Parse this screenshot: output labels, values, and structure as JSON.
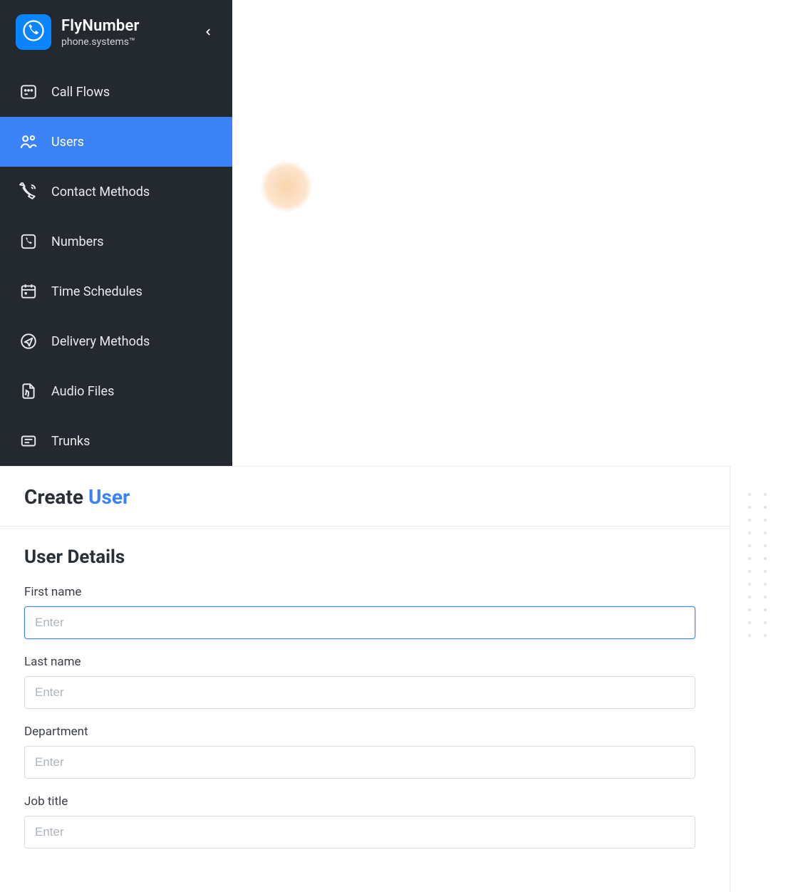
{
  "brand": {
    "name": "FlyNumber",
    "subtitle": "phone.systems™"
  },
  "sidebar": {
    "items": [
      {
        "label": "Call Flows"
      },
      {
        "label": "Users"
      },
      {
        "label": "Contact Methods"
      },
      {
        "label": "Numbers"
      },
      {
        "label": "Time Schedules"
      },
      {
        "label": "Delivery Methods"
      },
      {
        "label": "Audio Files"
      },
      {
        "label": "Trunks"
      }
    ],
    "active_index": 1
  },
  "header": {
    "title_prefix": "Create ",
    "title_accent": "User"
  },
  "form": {
    "section_title": "User Details",
    "fields": [
      {
        "label": "First name",
        "placeholder": "Enter",
        "value": ""
      },
      {
        "label": "Last name",
        "placeholder": "Enter",
        "value": ""
      },
      {
        "label": "Department",
        "placeholder": "Enter",
        "value": ""
      },
      {
        "label": "Job title",
        "placeholder": "Enter",
        "value": ""
      }
    ],
    "focused_index": 0
  }
}
